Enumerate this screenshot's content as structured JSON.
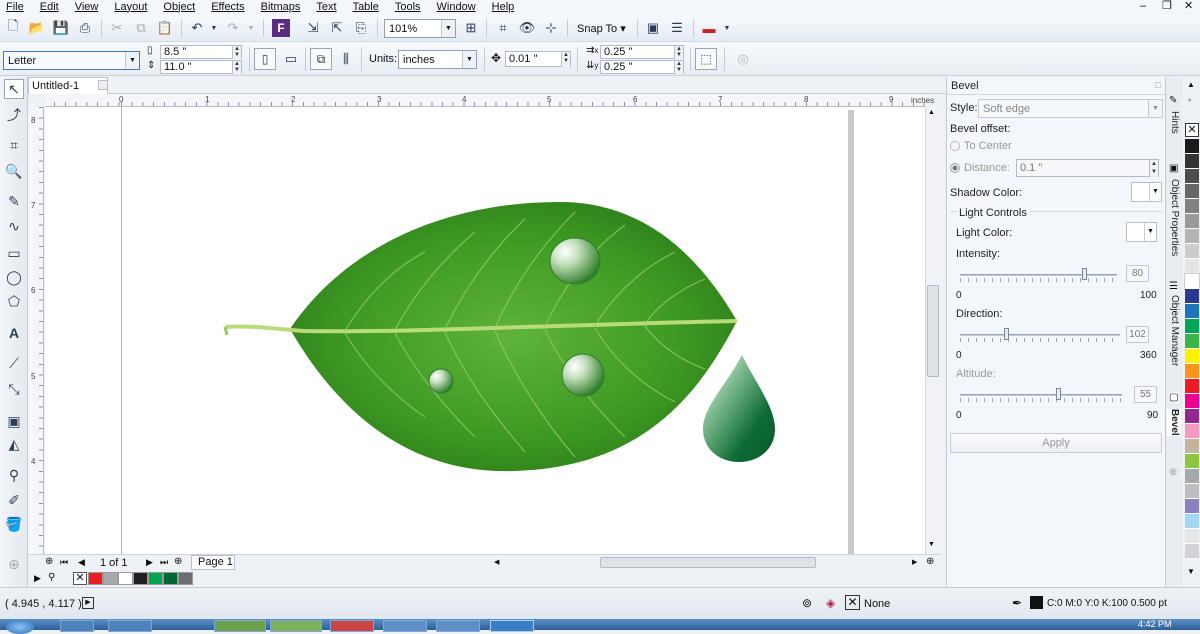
{
  "menu": [
    "File",
    "Edit",
    "View",
    "Layout",
    "Object",
    "Effects",
    "Bitmaps",
    "Text",
    "Table",
    "Tools",
    "Window",
    "Help"
  ],
  "toolbar": {
    "zoom": "101%",
    "snap_to": "Snap To"
  },
  "property_bar": {
    "page_size": "Letter",
    "width": "8.5 \"",
    "height": "11.0 \"",
    "units_label": "Units:",
    "units": "inches",
    "nudge": "0.01 \"",
    "dup_x": "0.25 \"",
    "dup_y": "0.25 \"",
    "dup_x_label": "x",
    "dup_y_label": "y"
  },
  "document": {
    "tab": "Untitled-1",
    "ruler_unit": "inches",
    "h_ruler_labels": [
      "0",
      "1",
      "2",
      "3",
      "4",
      "5",
      "6",
      "7",
      "8",
      "9"
    ],
    "v_ruler_labels": [
      "8",
      "7",
      "6",
      "5",
      "4"
    ]
  },
  "page_nav": {
    "page_count": "1 of 1",
    "page_tab": "Page 1"
  },
  "docker": {
    "title": "Bevel",
    "style_label": "Style:",
    "style_value": "Soft edge",
    "bevel_offset_label": "Bevel offset:",
    "to_center_label": "To Center",
    "distance_label": "Distance:",
    "distance_value": "0.1 \"",
    "shadow_color_label": "Shadow Color:",
    "light_controls_label": "Light Controls",
    "light_color_label": "Light Color:",
    "intensity": {
      "label": "Intensity:",
      "min": "0",
      "max": "100",
      "value": "80",
      "fraction": 0.8
    },
    "direction": {
      "label": "Direction:",
      "min": "0",
      "max": "360",
      "value": "102",
      "fraction": 0.283
    },
    "altitude": {
      "label": "Altitude:",
      "min": "0",
      "max": "90",
      "value": "55",
      "fraction": 0.611
    },
    "apply_label": "Apply"
  },
  "side_tabs": [
    "Hints",
    "Object Properties",
    "Object Manager",
    "Bevel"
  ],
  "palette_colors": [
    "#1a1a1a",
    "#333333",
    "#4d4d4d",
    "#666666",
    "#808080",
    "#999999",
    "#b3b3b3",
    "#cccccc",
    "#e6e6e6",
    "#ffffff",
    "#2b3990",
    "#1c75bc",
    "#00a651",
    "#39b54a",
    "#fff200",
    "#f7941d",
    "#ed1c24",
    "#ec008c",
    "#92278f",
    "#f49ac1",
    "#c2b59b",
    "#8dc63f",
    "#a7a9ac",
    "#bcbec0",
    "#8781bd",
    "#a3d6f5",
    "#e6e7e8",
    "#d1d3d4"
  ],
  "document_palette": [
    "#ed1c24",
    "#a7a9ac",
    "#ffffff",
    "#231f20",
    "#00a651",
    "#006838",
    "#6d6e71"
  ],
  "status": {
    "coordinates": "( 4.945 , 4.117 )",
    "fill_text": "None",
    "outline_text": "C:0 M:0 Y:0 K:100  0.500 pt",
    "clock": "4:42 PM"
  }
}
